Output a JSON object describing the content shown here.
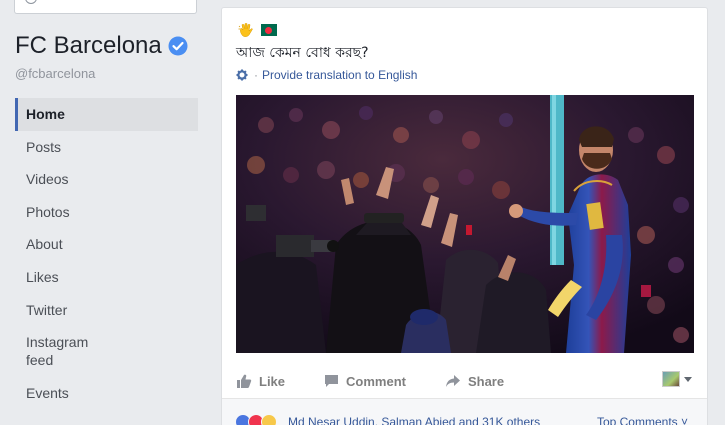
{
  "page": {
    "name": "FC Barcelona",
    "handle": "@fcbarcelona"
  },
  "nav": {
    "items": [
      {
        "label": "Home",
        "active": true
      },
      {
        "label": "Posts"
      },
      {
        "label": "Videos"
      },
      {
        "label": "Photos"
      },
      {
        "label": "About"
      },
      {
        "label": "Likes"
      },
      {
        "label": "Twitter"
      },
      {
        "label": "Instagram feed"
      },
      {
        "label": "Events"
      }
    ]
  },
  "post": {
    "emojis": [
      "waving-hand-icon",
      "bangladesh-flag-icon"
    ],
    "text": "আজ কেমন বোধ করছ?",
    "translate_separator": "·",
    "translate_link": "Provide translation to English",
    "image_icon": "celebration-photo"
  },
  "actions": {
    "like": "Like",
    "comment": "Comment",
    "share": "Share"
  },
  "reactions": {
    "icons": [
      "like-reaction-icon",
      "love-reaction-icon",
      "wow-reaction-icon"
    ],
    "summary": "Md Nesar Uddin, Salman Abied and 31K others",
    "top_comments": "Top Comments ˅"
  },
  "colors": {
    "accent": "#4267b2",
    "link": "#365899",
    "background": "#e9ebee",
    "barca_blue": "#004d98",
    "barca_red": "#a50044"
  }
}
